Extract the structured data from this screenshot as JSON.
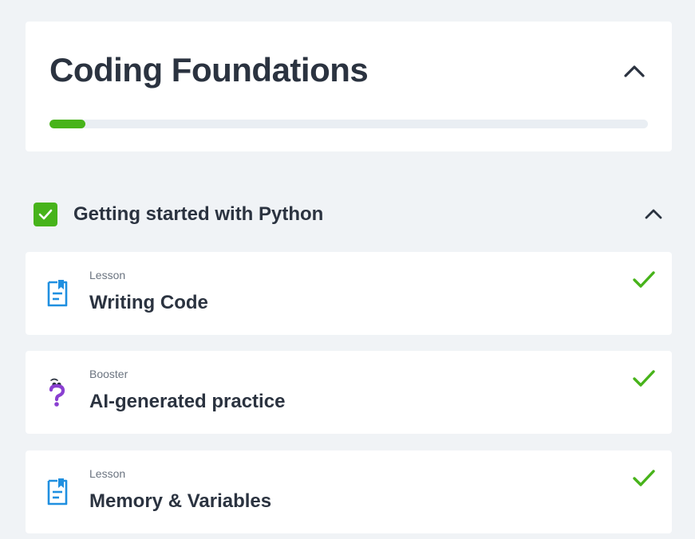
{
  "course": {
    "title": "Coding Foundations",
    "progress_percent": 6,
    "accent_color": "#47b31a"
  },
  "section": {
    "title": "Getting started with Python",
    "completed": true
  },
  "items": [
    {
      "type": "Lesson",
      "title": "Writing Code",
      "icon": "lesson-document-icon",
      "completed": true
    },
    {
      "type": "Booster",
      "title": "AI-generated practice",
      "icon": "question-mark-icon",
      "completed": true
    },
    {
      "type": "Lesson",
      "title": "Memory & Variables",
      "icon": "lesson-document-icon",
      "completed": true
    }
  ]
}
